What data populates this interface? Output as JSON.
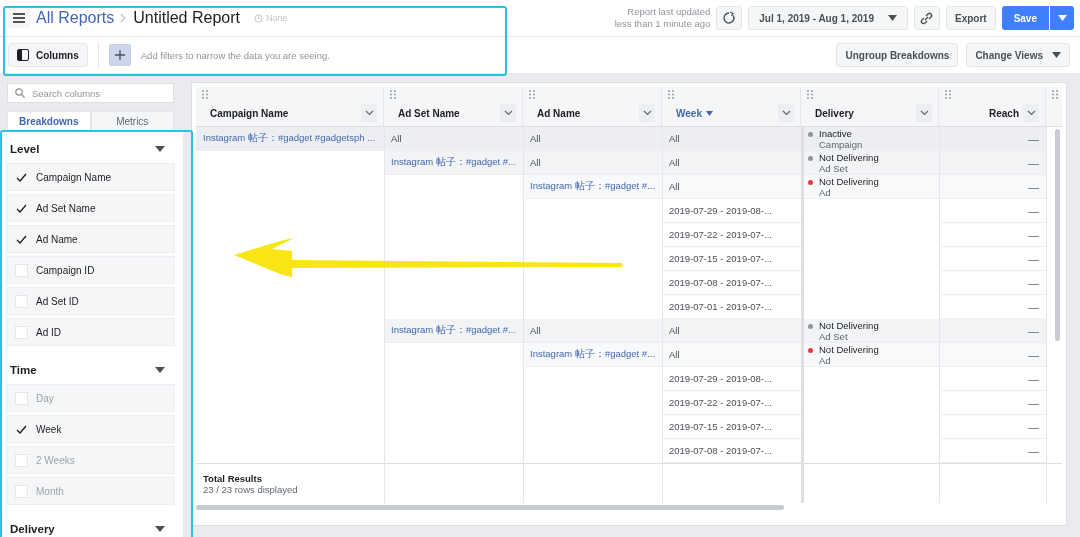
{
  "topbar": {
    "breadcrumb_link": "All Reports",
    "title": "Untitled Report",
    "schedule": "None",
    "updated_line_1": "Report last updated",
    "updated_line_2": "less than 1 minute ago",
    "date_range": "Jul 1, 2019 - Aug 1, 2019",
    "export": "Export",
    "save": "Save"
  },
  "toolbar": {
    "columns_button": "Columns",
    "filter_placeholder": "Add filters to narrow the data you are seeing.",
    "ungroup": "Ungroup Breakdowns",
    "change_views": "Change Views"
  },
  "sidebar": {
    "search_placeholder": "Search columns",
    "tabs": [
      {
        "label": "Breakdowns",
        "selected": true
      },
      {
        "label": "Metrics",
        "selected": false
      }
    ],
    "sections": [
      {
        "title": "Level",
        "expanded": true,
        "items": [
          {
            "label": "Campaign Name",
            "checked": true,
            "disabled": false
          },
          {
            "label": "Ad Set Name",
            "checked": true,
            "disabled": false
          },
          {
            "label": "Ad Name",
            "checked": true,
            "disabled": false
          },
          {
            "label": "Campaign ID",
            "checked": false,
            "disabled": false
          },
          {
            "label": "Ad Set ID",
            "checked": false,
            "disabled": false
          },
          {
            "label": "Ad ID",
            "checked": false,
            "disabled": false
          }
        ]
      },
      {
        "title": "Time",
        "expanded": true,
        "items": [
          {
            "label": "Day",
            "checked": false,
            "disabled": true
          },
          {
            "label": "Week",
            "checked": true,
            "disabled": false
          },
          {
            "label": "2 Weeks",
            "checked": false,
            "disabled": true
          },
          {
            "label": "Month",
            "checked": false,
            "disabled": true
          }
        ]
      },
      {
        "title": "Delivery",
        "expanded": true
      }
    ]
  },
  "table": {
    "columns": [
      {
        "label": "Campaign Name",
        "sorted": false
      },
      {
        "label": "Ad Set Name",
        "sorted": false
      },
      {
        "label": "Ad Name",
        "sorted": false
      },
      {
        "label": "Week",
        "sorted": true
      },
      {
        "label": "Delivery",
        "sorted": false
      },
      {
        "label": "Reach",
        "sorted": false
      }
    ],
    "rows": [
      {
        "cells": [
          "Instagram 帖子：#gadget #gadgetsph ...",
          "All",
          "All",
          "All",
          {
            "status": "Inactive",
            "level": "Campaign",
            "color": "#8d949e"
          },
          "—"
        ]
      },
      {
        "cells": [
          null,
          "Instagram 帖子：#gadget #...",
          "All",
          "All",
          {
            "status": "Not Delivering",
            "level": "Ad Set",
            "color": "#8d949e"
          },
          "—"
        ]
      },
      {
        "cells": [
          null,
          null,
          "Instagram 帖子：#gadget #...",
          "All",
          {
            "status": "Not Delivering",
            "level": "Ad",
            "color": "#e0393e"
          },
          "—"
        ]
      },
      {
        "cells": [
          null,
          null,
          null,
          "2019-07-29 - 2019-08-...",
          null,
          "—"
        ]
      },
      {
        "cells": [
          null,
          null,
          null,
          "2019-07-22 - 2019-07-...",
          null,
          "—"
        ]
      },
      {
        "cells": [
          null,
          null,
          null,
          "2019-07-15 - 2019-07-...",
          null,
          "—"
        ]
      },
      {
        "cells": [
          null,
          null,
          null,
          "2019-07-08 - 2019-07-...",
          null,
          "—"
        ]
      },
      {
        "cells": [
          null,
          null,
          null,
          "2019-07-01 - 2019-07-...",
          null,
          "—"
        ]
      },
      {
        "cells": [
          null,
          "Instagram 帖子：#gadget #...",
          "All",
          "All",
          {
            "status": "Not Delivering",
            "level": "Ad Set",
            "color": "#8d949e"
          },
          "—"
        ]
      },
      {
        "cells": [
          null,
          null,
          "Instagram 帖子：#gadget #...",
          "All",
          {
            "status": "Not Delivering",
            "level": "Ad",
            "color": "#e0393e"
          },
          "—"
        ]
      },
      {
        "cells": [
          null,
          null,
          null,
          "2019-07-29 - 2019-08-...",
          null,
          "—"
        ]
      },
      {
        "cells": [
          null,
          null,
          null,
          "2019-07-22 - 2019-07-...",
          null,
          "—"
        ]
      },
      {
        "cells": [
          null,
          null,
          null,
          "2019-07-15 - 2019-07-...",
          null,
          "—"
        ]
      },
      {
        "cells": [
          null,
          null,
          null,
          "2019-07-08 - 2019-07-...",
          null,
          "—"
        ]
      }
    ],
    "footer": {
      "total_label": "Total Results",
      "rows_displayed": "23 / 23 rows displayed"
    }
  }
}
